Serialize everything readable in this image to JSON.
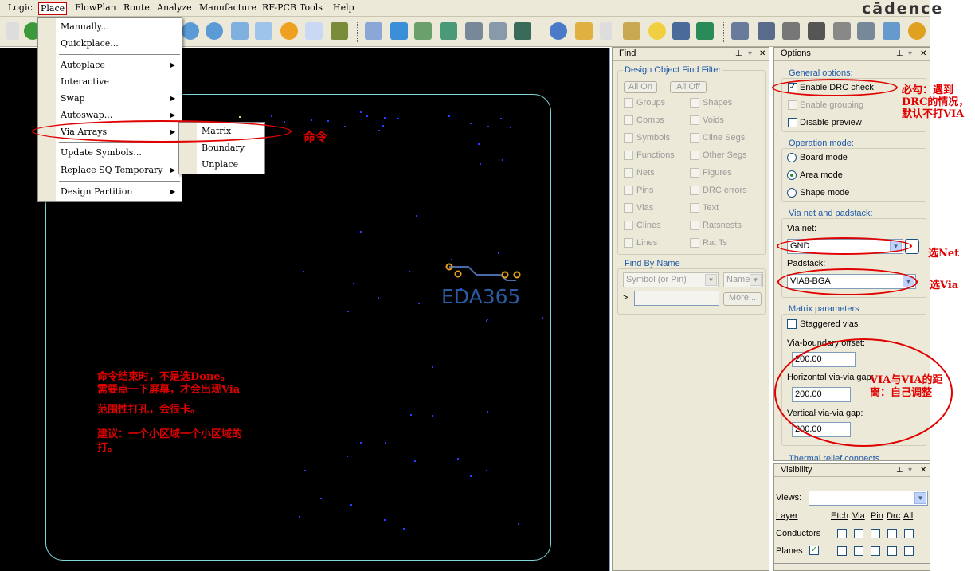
{
  "menubar": {
    "items": [
      "Logic",
      "Place",
      "FlowPlan",
      "Route",
      "Analyze",
      "Manufacture",
      "RF-PCB",
      "Tools",
      "Help"
    ],
    "brand": "cādence"
  },
  "place_menu": {
    "items": [
      "Manually...",
      "Quickplace...",
      "Autoplace",
      "Interactive",
      "Swap",
      "Autoswap...",
      "Via Arrays",
      "Update Symbols...",
      "Replace SQ Temporary",
      "Design Partition"
    ],
    "submenu": [
      "Matrix",
      "Boundary",
      "Unplace"
    ]
  },
  "watermark": "EDA365",
  "find": {
    "title": "Find",
    "filter_title": "Design Object Find Filter",
    "all_on": "All On",
    "all_off": "All Off",
    "left_items": [
      "Groups",
      "Comps",
      "Symbols",
      "Functions",
      "Nets",
      "Pins",
      "Vias",
      "Clines",
      "Lines"
    ],
    "right_items": [
      "Shapes",
      "Voids",
      "Cline Segs",
      "Other Segs",
      "Figures",
      "DRC errors",
      "Text",
      "Ratsnests",
      "Rat Ts"
    ],
    "by_name_title": "Find By Name",
    "by_name_select": "Symbol (or Pin)",
    "name_select": "Name",
    "prompt": ">",
    "more": "More..."
  },
  "options": {
    "title": "Options",
    "general_title": "General options:",
    "enable_drc": "Enable DRC check",
    "enable_grouping": "Enable grouping",
    "disable_preview": "Disable preview",
    "operation_title": "Operation mode:",
    "modes": [
      "Board mode",
      "Area mode",
      "Shape mode"
    ],
    "selected_mode": "Area mode",
    "via_title": "Via net and padstack:",
    "via_net_label": "Via net:",
    "via_net_value": "GND",
    "padstack_label": "Padstack:",
    "padstack_value": "VIA8-BGA",
    "matrix_title": "Matrix parameters",
    "staggered": "Staggered vias",
    "boundary_offset_label": "Via-boundary offset:",
    "boundary_offset_value": "200.00",
    "hgap_label": "Horizontal via-via gap:",
    "hgap_value": "200.00",
    "vgap_label": "Vertical via-via gap:",
    "vgap_value": "200.00",
    "thermal_label": "Thermal relief connects"
  },
  "visibility": {
    "title": "Visibility",
    "views_label": "Views:",
    "layer_label": "Layer",
    "columns": [
      "Etch",
      "Via",
      "Pin",
      "Drc",
      "All"
    ],
    "rows": [
      "Conductors",
      "Planes"
    ]
  },
  "annotations": {
    "command": "命令",
    "drc_note": [
      "必勾：遇到",
      "DRC的情况，",
      "默认不打VIA"
    ],
    "select_net": "选Net",
    "select_via": "选Via",
    "gap_note": [
      "VIA与VIA的距",
      "离：自己调整"
    ],
    "canvas_note": [
      "命令结束时，不是选Done。",
      "需要点一下屏幕，才会出现Via",
      "范围性打孔，会很卡。",
      "建议：一个小区域一个小区域的",
      "打。"
    ]
  },
  "colors": {
    "annotation": "#e00000",
    "board_outline": "#7fd7d7",
    "canvas": "#000000",
    "group_label": "#1e5aa8"
  }
}
